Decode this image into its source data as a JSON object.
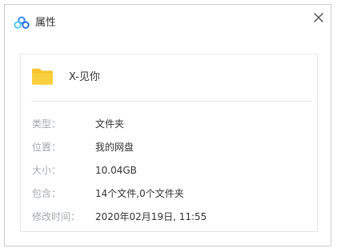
{
  "window": {
    "title": "属性",
    "app_icon": "baidu-netdisk-cloud-icon",
    "close_icon": "close-icon"
  },
  "file": {
    "name": "X-见你",
    "icon": "folder-icon",
    "icon_color": "#f8c932"
  },
  "properties": [
    {
      "label": "类型：",
      "value": "文件夹"
    },
    {
      "label": "位置：",
      "value": "我的网盘"
    },
    {
      "label": "大小：",
      "value": "10.04GB"
    },
    {
      "label": "包含：",
      "value": "14个文件,0个文件夹"
    },
    {
      "label": "修改时间：",
      "value": "2020年02月19日, 11:55"
    }
  ]
}
